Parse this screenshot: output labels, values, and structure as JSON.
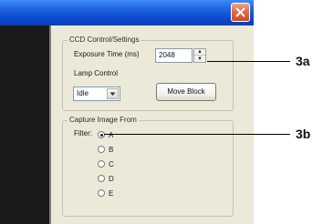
{
  "ccd_group": {
    "legend": "CCD Control/Settings",
    "exposure_label": "Exposure Time (ms)",
    "exposure_value": "2048",
    "lamp_label": "Lamp Control",
    "lamp_value": "Idle",
    "move_block_label": "Move Block"
  },
  "capture_group": {
    "legend": "Capture Image From",
    "filter_label": "Filter:",
    "options": [
      "A",
      "B",
      "C",
      "D",
      "E"
    ],
    "selected": "A"
  },
  "callouts": {
    "a": "3a",
    "b": "3b"
  },
  "colors": {
    "titlebar": "#0a4bd1",
    "close_button": "#e06b4a",
    "dialog_bg": "#ece9d8",
    "dark_panel": "#1a1a1a"
  },
  "icons": {
    "close": "close-icon",
    "spin_up": "spin-up-icon",
    "spin_down": "spin-down-icon",
    "dropdown": "chevron-down-icon"
  }
}
